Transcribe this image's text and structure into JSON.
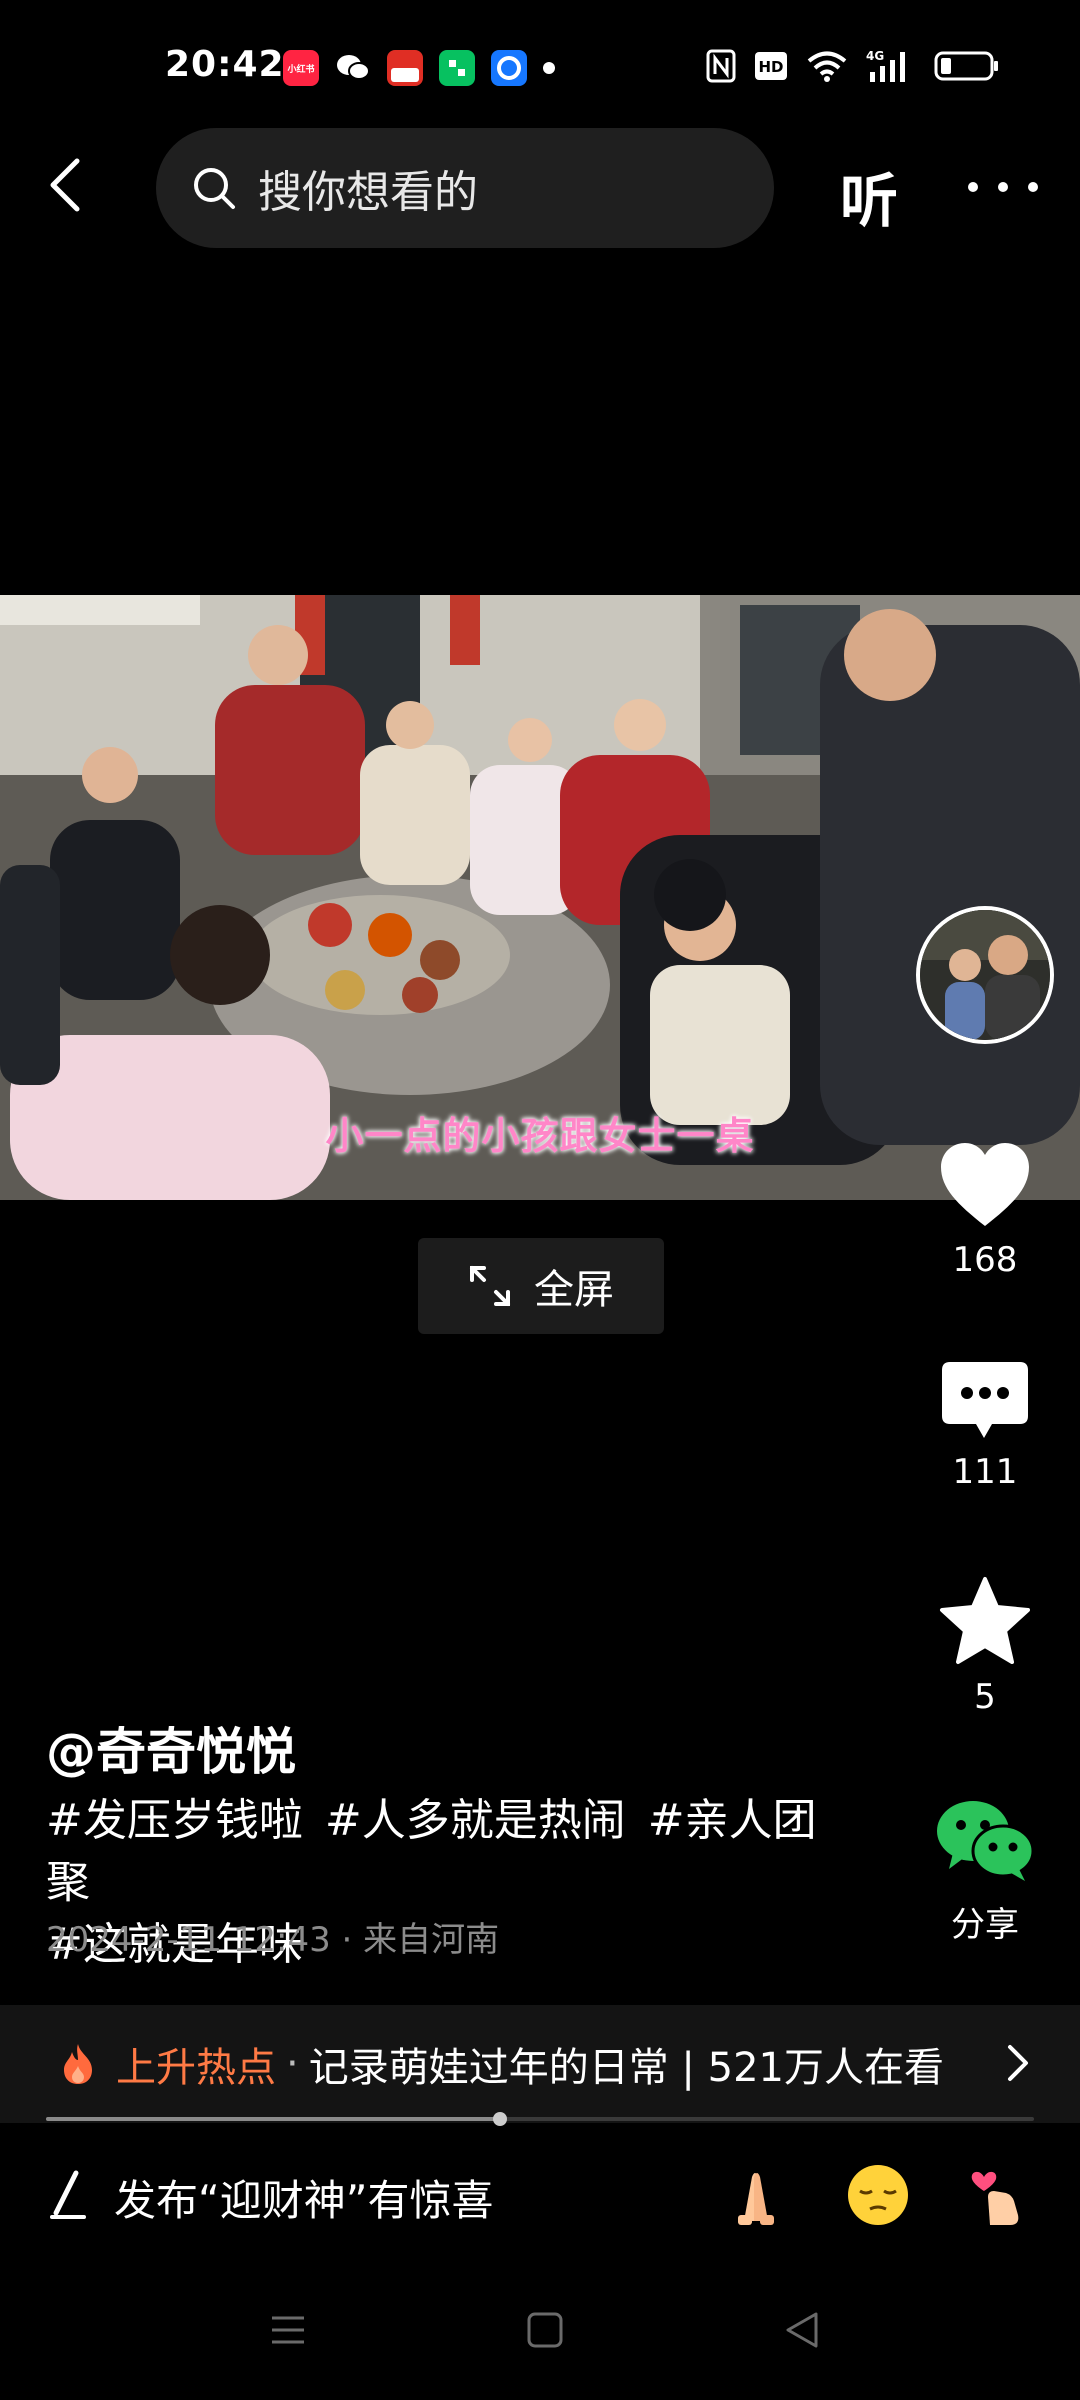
{
  "status_bar": {
    "time": "20:42",
    "notifications": [
      "小红书",
      "wechat-icon",
      "pinduoduo-icon",
      "wechat-mini-icon",
      "qq-browser-icon"
    ],
    "system": [
      "nfc-icon",
      "hd-icon",
      "wifi-icon",
      "4g-signal-icon",
      "battery-icon"
    ]
  },
  "top_nav": {
    "search_placeholder": "搜你想看的",
    "listen_label": "听"
  },
  "video": {
    "caption": "小一点的小孩跟女士一桌"
  },
  "fullscreen_label": "全屏",
  "rail": {
    "like_count": "168",
    "comment_count": "111",
    "favorite_count": "5",
    "share_label": "分享"
  },
  "post": {
    "author": "@奇奇悦悦",
    "tags": [
      "#发压岁钱啦",
      "#人多就是热闹",
      "#亲人团聚",
      "#这就是年味"
    ],
    "meta": "2024-2-11 12:43 · 来自河南"
  },
  "hot_topic": {
    "label": "上升热点",
    "separator": "·",
    "text": "记录萌娃过年的日常 | 521万人在看"
  },
  "progress": 0.46,
  "comment_bar": {
    "prompt": "发布“迎财神”有惊喜",
    "emojis": [
      "pray-emoji",
      "relieved-emoji",
      "heart-hand-emoji"
    ]
  },
  "colors": {
    "hot_accent": "#ff7a45",
    "caption": "#ff86c8",
    "wechat_green": "#2bc35b"
  }
}
